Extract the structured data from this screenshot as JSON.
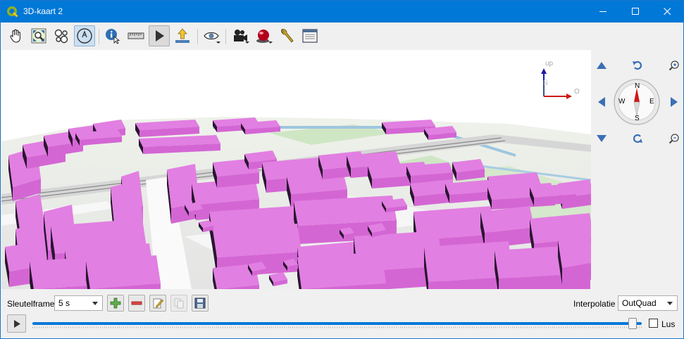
{
  "window": {
    "title": "3D-kaart 2",
    "app_icon": "qgis-logo-icon",
    "controls": [
      "minimize-icon",
      "maximize-icon",
      "close-icon"
    ],
    "titlebar_color": "#0078d7"
  },
  "toolbar": {
    "items": [
      {
        "name": "pan-camera-icon",
        "state": "normal"
      },
      {
        "name": "zoom-full-icon",
        "state": "normal"
      },
      {
        "name": "identify-icon",
        "state": "normal"
      },
      {
        "name": "camera-control-icon",
        "state": "active"
      },
      {
        "name": "identify-info-icon",
        "state": "normal"
      },
      {
        "name": "measure-line-icon",
        "state": "normal"
      },
      {
        "name": "animation-play-icon",
        "state": "pressed"
      },
      {
        "name": "export-scene-icon",
        "state": "normal"
      },
      {
        "name": "view-options-icon",
        "state": "normal"
      },
      {
        "name": "camera-effects-icon",
        "state": "normal"
      },
      {
        "name": "shadows-icon",
        "state": "normal"
      },
      {
        "name": "configure-icon",
        "state": "normal"
      },
      {
        "name": "docked-panel-icon",
        "state": "normal"
      }
    ]
  },
  "scene": {
    "axis_labels": {
      "up": "up",
      "north": "N",
      "east": "O"
    },
    "building_color": "#d466d4",
    "building_top_color": "#e27fe2"
  },
  "navigation": {
    "compass": {
      "n": "N",
      "e": "E",
      "s": "S",
      "w": "W"
    }
  },
  "animation": {
    "keyframe_label": "Sleutelframe",
    "keyframe_value": "5 s",
    "interpolation_label": "Interpolatie",
    "interpolation_value": "OutQuad",
    "loop_label": "Lus",
    "loop_checked": false,
    "progress": 0.99,
    "buttons": [
      "add-keyframe-icon",
      "remove-keyframe-icon",
      "edit-keyframe-icon",
      "duplicate-keyframe-icon",
      "save-keyframe-icon"
    ]
  }
}
